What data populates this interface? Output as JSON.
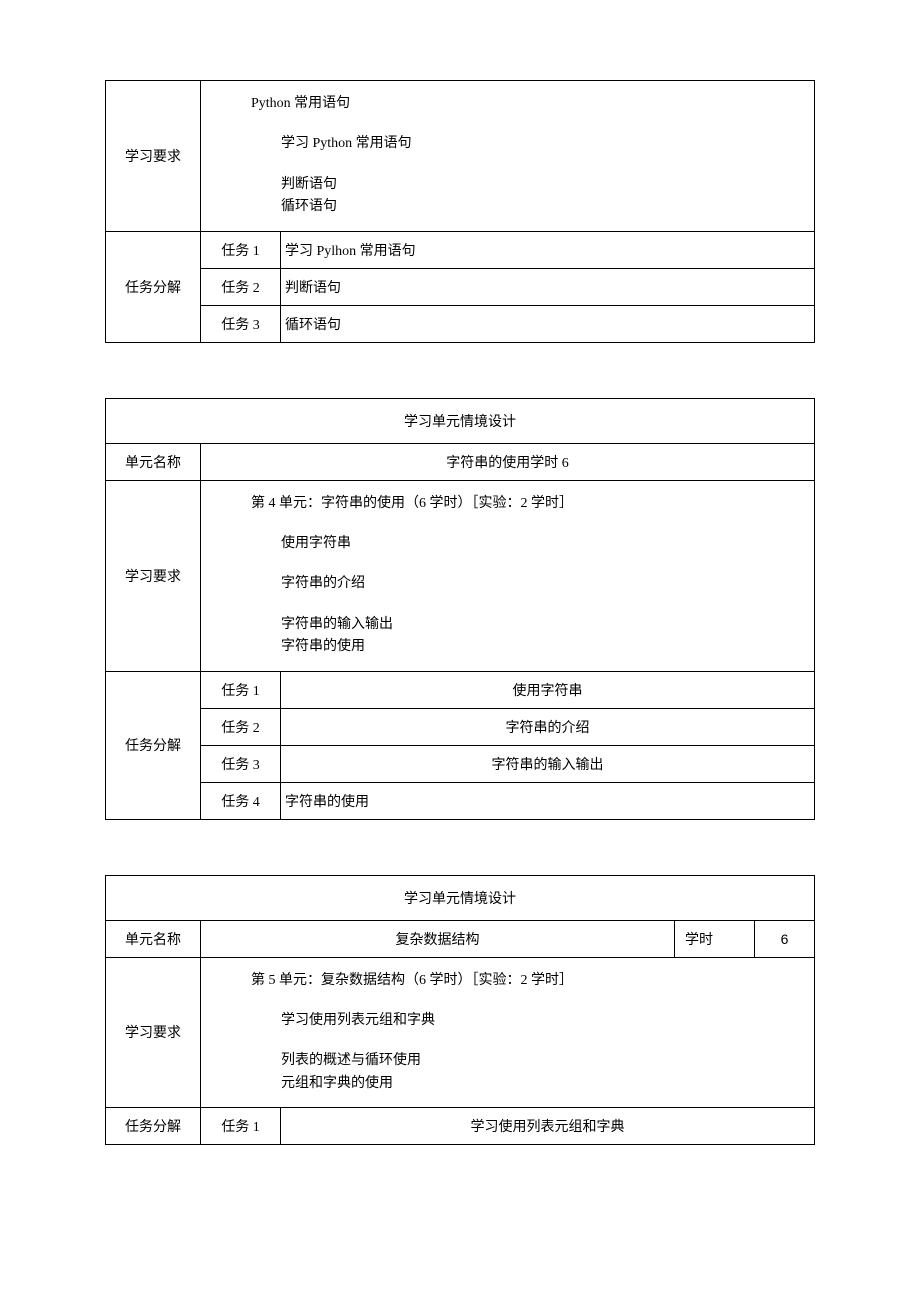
{
  "t1": {
    "req_label": "学习要求",
    "req_title": "Python 常用语句",
    "req_line1": "学习 Python 常用语句",
    "req_line2": "判断语句",
    "req_line3": "循环语句",
    "task_label": "任务分解",
    "task1_num": "任务 1",
    "task1_desc": "学习 Pylhon 常用语句",
    "task2_num": "任务 2",
    "task2_desc": "判断语句",
    "task3_num": "任务 3",
    "task3_desc": "循环语句"
  },
  "t2": {
    "header": "学习单元情境设计",
    "unit_label": "单元名称",
    "unit_value": "字符串的使用学时 6",
    "req_label": "学习要求",
    "req_title": "第 4 单元：字符串的使用（6 学时）［实验：2 学时］",
    "req_line1": "使用字符串",
    "req_line2": "字符串的介绍",
    "req_line3": "字符串的输入输出",
    "req_line4": "字符串的使用",
    "task_label": "任务分解",
    "task1_num": "任务 1",
    "task1_desc": "使用字符串",
    "task2_num": "任务 2",
    "task2_desc": "字符串的介绍",
    "task3_num": "任务 3",
    "task3_desc": "字符串的输入输出",
    "task4_num": "任务 4",
    "task4_desc": "字符串的使用"
  },
  "t3": {
    "header": "学习单元情境设计",
    "unit_label": "单元名称",
    "unit_value": "复杂数据结构",
    "hours_label": "学时",
    "hours_value": "6",
    "req_label": "学习要求",
    "req_title": "第 5 单元：复杂数据结构（6 学时）［实验：2 学时］",
    "req_line1": "学习使用列表元组和字典",
    "req_line2": "列表的概述与循环使用",
    "req_line3": "元组和字典的使用",
    "task_label": "任务分解",
    "task1_num": "任务 1",
    "task1_desc": "学习使用列表元组和字典"
  }
}
